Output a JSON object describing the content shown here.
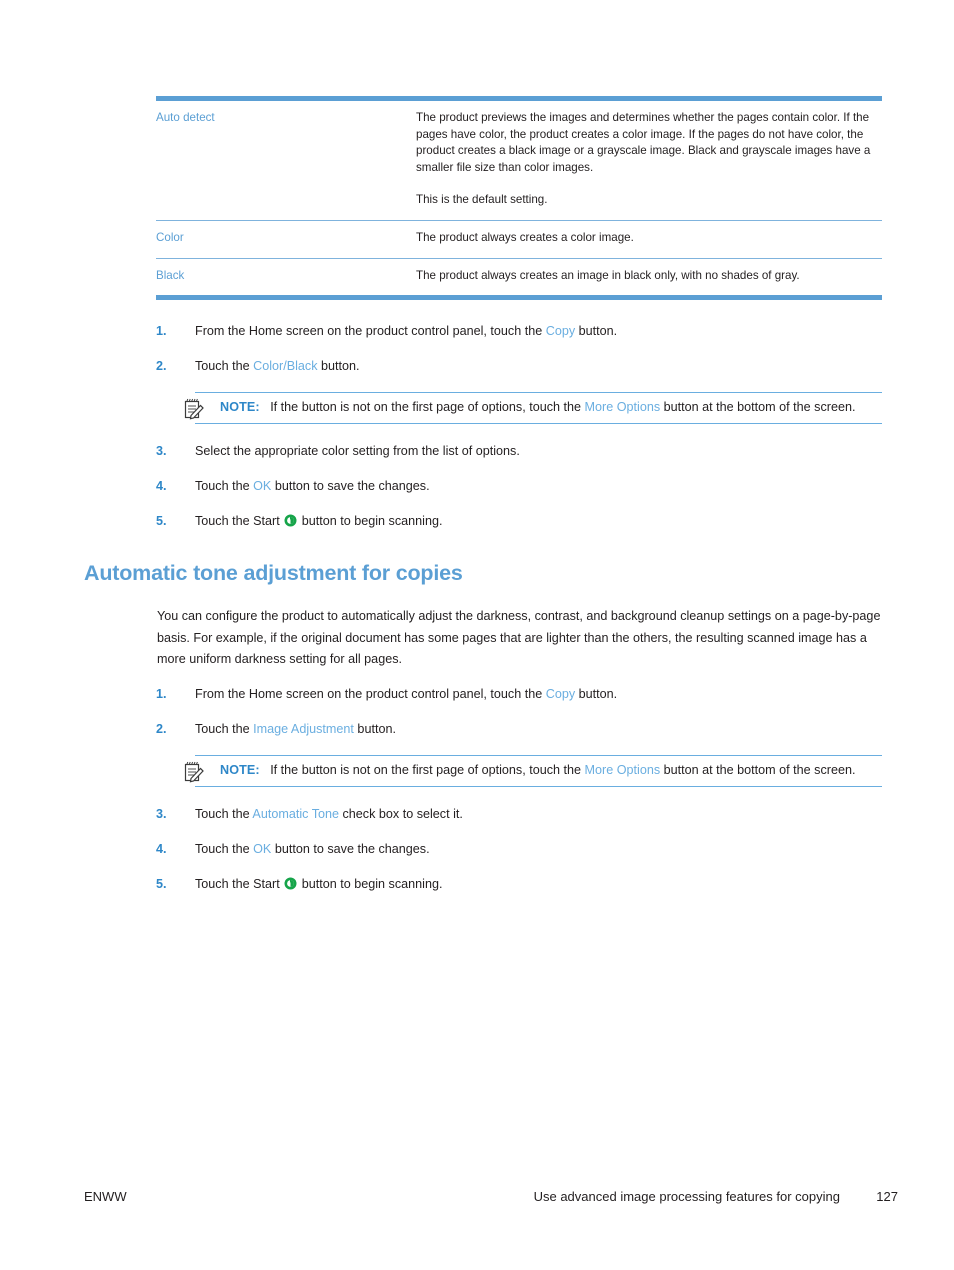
{
  "document": {
    "page_number": "127",
    "footer_left": "ENWW",
    "footer_title": "Use advanced image processing features for copying"
  },
  "options_table": {
    "rows": [
      {
        "term": "Auto detect",
        "paragraphs": [
          "The product previews the images and determines whether the pages contain color. If the pages have color, the product creates a color image. If the pages do not have color, the product creates a black image or a grayscale image. Black and grayscale images have a smaller file size than color images.",
          "This is the default setting."
        ]
      },
      {
        "term": "Color",
        "paragraphs": [
          "The product always creates a color image."
        ]
      },
      {
        "term": "Black",
        "paragraphs": [
          "The product always creates an image in black only, with no shades of gray."
        ]
      }
    ]
  },
  "section_color_black": {
    "steps": [
      {
        "num": "1.",
        "pre": "From the Home screen on the product control panel, touch the ",
        "link": "Copy",
        "post": " button."
      },
      {
        "num": "2.",
        "pre": "Touch the ",
        "link": "Color/Black",
        "post": " button."
      },
      {
        "num": "3.",
        "pre": "Select the appropriate color setting from the list of options.",
        "link": "",
        "post": ""
      },
      {
        "num": "4.",
        "pre": "Touch the ",
        "link": "OK",
        "post": " button to save the changes."
      },
      {
        "num": "5.",
        "pre": "Touch the Start ",
        "link": "",
        "post": " button to begin scanning."
      }
    ],
    "note": {
      "label": "NOTE:",
      "pre": "If the button is not on the first page of options, touch the ",
      "link": "More Options",
      "post": " button at the bottom of the screen."
    }
  },
  "section_auto_tone": {
    "heading": "Automatic tone adjustment for copies",
    "intro": "You can configure the product to automatically adjust the darkness, contrast, and background cleanup settings on a page-by-page basis. For example, if the original document has some pages that are lighter than the others, the resulting scanned image has a more uniform darkness setting for all pages.",
    "steps": [
      {
        "num": "1.",
        "pre": "From the Home screen on the product control panel, touch the ",
        "link": "Copy",
        "post": " button."
      },
      {
        "num": "2.",
        "pre": "Touch the ",
        "link": "Image Adjustment",
        "post": " button."
      },
      {
        "num": "3.",
        "pre": "Touch the ",
        "link": "Automatic Tone",
        "post": " check box to select it."
      },
      {
        "num": "4.",
        "pre": "Touch the ",
        "link": "OK",
        "post": " button to save the changes."
      },
      {
        "num": "5.",
        "pre": "Touch the Start ",
        "link": "",
        "post": " button to begin scanning."
      }
    ],
    "note": {
      "label": "NOTE:",
      "pre": "If the button is not on the first page of options, touch the ",
      "link": "More Options",
      "post": " button at the bottom of the screen."
    }
  },
  "colors": {
    "accent_blue": "#5b9fd4",
    "link_blue": "#6aaee0",
    "number_blue": "#2e87c8",
    "body_text": "#231f20",
    "start_green": "#16a44a"
  },
  "icons": {
    "note": "note-pad-pencil-icon",
    "start": "start-green-button-icon"
  }
}
